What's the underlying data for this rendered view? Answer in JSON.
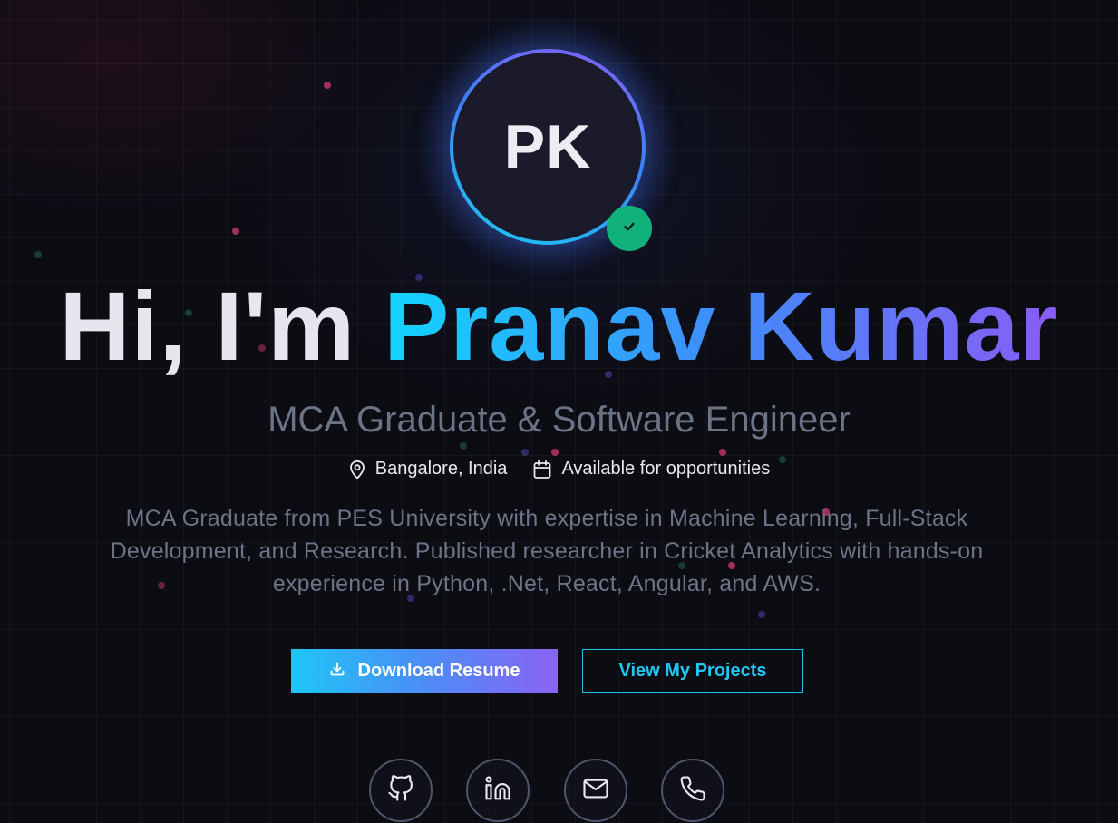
{
  "avatar": {
    "initials": "PK",
    "badge_icon": "check-icon",
    "ring_colors": [
      "#1ec8f4",
      "#3b82f6",
      "#8a5cf6"
    ],
    "badge_color": "#10b27a"
  },
  "hero": {
    "greeting": "Hi, I'm",
    "name": "Pranav Kumar",
    "subtitle": "MCA Graduate & Software Engineer",
    "location": "Bangalore, India",
    "availability": "Available for opportunities",
    "bio": "MCA Graduate from PES University with expertise in Machine Learning, Full-Stack Development, and Research. Published researcher in Cricket Analytics with hands-on experience in Python, .Net, React, Angular, and AWS."
  },
  "meta_icons": {
    "location": "map-pin-icon",
    "availability": "calendar-icon"
  },
  "buttons": {
    "download_resume": "Download Resume",
    "download_icon": "download-icon",
    "view_projects": "View My Projects"
  },
  "social": [
    {
      "icon": "github-icon"
    },
    {
      "icon": "linkedin-icon"
    },
    {
      "icon": "mail-icon"
    },
    {
      "icon": "phone-icon"
    }
  ],
  "colors": {
    "accent_cyan": "#1ec6f6",
    "accent_blue": "#4c8cf6",
    "accent_violet": "#8a63f5",
    "background": "#0c0c13",
    "muted_text": "#6c7487"
  }
}
